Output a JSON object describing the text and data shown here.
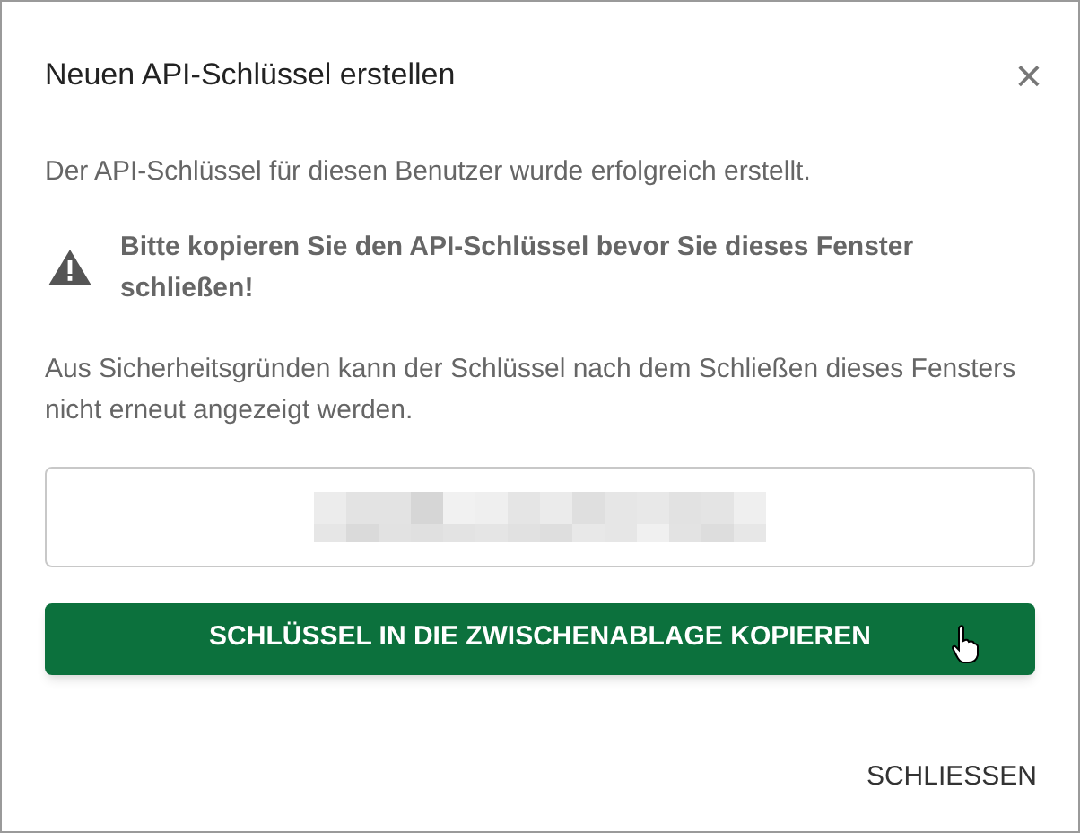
{
  "dialog": {
    "title": "Neuen API-Schlüssel erstellen",
    "close_icon": "×",
    "message": "Der API-Schlüssel für diesen Benutzer wurde erfolgreich erstellt.",
    "warning": "Bitte kopieren Sie den API-Schlüssel bevor Sie dieses Fenster schließen!",
    "note": "Aus Sicherheitsgründen kann der Schlüssel nach dem Schließen dieses Fensters nicht erneut angezeigt werden.",
    "key_field": {
      "redacted": true
    },
    "copy_button": "SCHLÜSSEL IN DIE ZWISCHENABLAGE KOPIEREN",
    "close_button": "SCHLIESSEN"
  }
}
